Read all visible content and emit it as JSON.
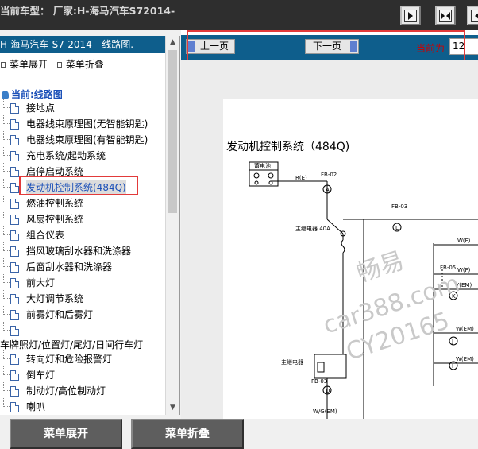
{
  "window": {
    "title": "当前车型：  厂家:H-海马汽车S72014-"
  },
  "left_panel": {
    "header": "H-海马汽车-S7-2014-- 线路图.",
    "expand_label": "菜单展开",
    "collapse_label": "菜单折叠",
    "root_label": "当前:线路图",
    "items": [
      "接地点",
      "电器线束原理图(无智能钥匙)",
      "电器线束原理图(有智能钥匙)",
      "充电系统/起动系统",
      "启停启动系统",
      "发动机控制系统(484Q)",
      "燃油控制系统",
      "风扇控制系统",
      "组合仪表",
      "挡风玻璃刮水器和洗涤器",
      "后窗刮水器和洗涤器",
      "前大灯",
      "大灯调节系统",
      "前雾灯和后雾灯",
      "",
      "车牌照灯/位置灯/尾灯/日间行车灯",
      "转向灯和危险报警灯",
      "倒车灯",
      "制动灯/高位制动灯",
      "喇叭"
    ]
  },
  "bottom_bar": {
    "expand_button": "菜单展开",
    "collapse_button": "菜单折叠"
  },
  "viewer": {
    "prev_button": "上一页",
    "next_button": "下一页",
    "current_page_label": "当前为",
    "current_page_value": "12"
  },
  "diagram": {
    "title": "发动机控制系统（484Q)",
    "labels": {
      "battery": "蓄电池",
      "re": "R(E)",
      "fb02": "FB-02",
      "a": "A",
      "fb03a": "FB-03",
      "l": "L",
      "main_fuse": "主继电器 40A",
      "main_relay": "主继电器",
      "fb03b": "FB-03",
      "d": "D",
      "wg": "W/G(EM)",
      "wf1": "W(F)",
      "fb05": "FB-05",
      "wf2": "W(F)",
      "ywem": "Y(EM)",
      "k": "K",
      "wem1": "W(EM)",
      "j": "J",
      "wem2": "W(EM)",
      "i": "I"
    },
    "watermark": {
      "line1": "畅易",
      "line2": "car388.com",
      "line3": "CY20165"
    }
  }
}
